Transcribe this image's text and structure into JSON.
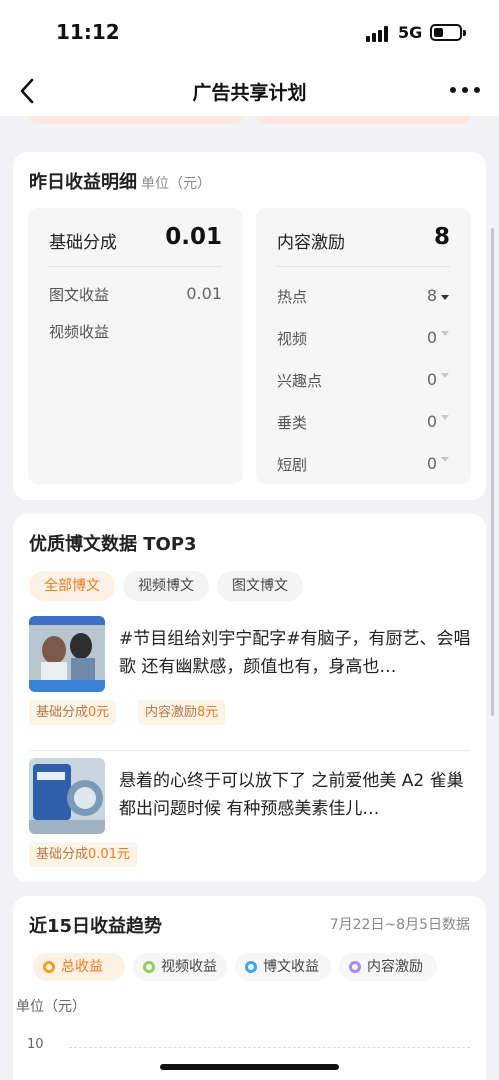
{
  "status_bar": {
    "time": "11:12",
    "network": "5G"
  },
  "nav": {
    "title": "广告共享计划",
    "back_icon": "chevron-left-icon",
    "more_icon": "more-dots-icon"
  },
  "yesterday": {
    "title": "昨日收益明细",
    "unit": "单位（元）",
    "base": {
      "label": "基础分成",
      "value": "0.01",
      "rows": [
        {
          "label": "图文收益",
          "value": "0.01"
        },
        {
          "label": "视频收益",
          "value": ""
        }
      ]
    },
    "incentive": {
      "label": "内容激励",
      "value": "8",
      "rows": [
        {
          "label": "热点",
          "value": "8",
          "expanded": true
        },
        {
          "label": "视频",
          "value": "0",
          "expanded": false
        },
        {
          "label": "兴趣点",
          "value": "0",
          "expanded": false
        },
        {
          "label": "垂类",
          "value": "0",
          "expanded": false
        },
        {
          "label": "短剧",
          "value": "0",
          "expanded": false
        }
      ]
    }
  },
  "top3": {
    "title": "优质博文数据 TOP3",
    "tabs": [
      {
        "label": "全部博文",
        "active": true
      },
      {
        "label": "视频博文",
        "active": false
      },
      {
        "label": "图文博文",
        "active": false
      }
    ],
    "posts": [
      {
        "text": "#节目组给刘宇宁配字#有脑子，有厨艺、会唱歌 还有幽默感，颜值也有，身高也…",
        "tags": [
          {
            "label": "基础分成",
            "value": "0元"
          },
          {
            "label": "内容激励",
            "value": "8元"
          }
        ]
      },
      {
        "text": "悬着的心终于可以放下了 之前爱他美 A2 雀巢 都出问题时候 有种预感美素佳儿…",
        "tags": [
          {
            "label": "基础分成",
            "value": "0.01元"
          }
        ]
      }
    ]
  },
  "trend": {
    "title": "近15日收益趋势",
    "range": "7月22日~8月5日数据",
    "legend": [
      {
        "label": "总收益",
        "color": "#f4a01f",
        "active": true
      },
      {
        "label": "视频收益",
        "color": "#8fcf5a",
        "active": false
      },
      {
        "label": "博文收益",
        "color": "#3fa2f7",
        "active": false
      },
      {
        "label": "内容激励",
        "color": "#a48cf0",
        "active": false
      }
    ],
    "y_unit": "单位（元）",
    "y_ticks": [
      "10"
    ]
  },
  "colors": {
    "accent": "#f47a1f",
    "page_bg": "#f2f2f4"
  }
}
